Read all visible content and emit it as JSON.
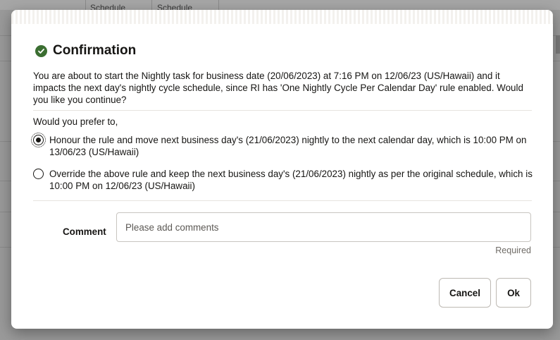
{
  "background": {
    "columns": [
      "Schedule",
      "Schedule"
    ]
  },
  "dialog": {
    "title": "Confirmation",
    "icon": "check-circle-icon",
    "accent_color": "#3b6e31",
    "message": "You are about to start the Nightly task for business date (20/06/2023) at 7:16 PM on 12/06/23 (US/Hawaii) and it impacts the next day's nightly cycle schedule, since RI has 'One Nightly Cycle Per Calendar Day' rule enabled. Would you like you continue?",
    "prompt": "Would you prefer to,",
    "options": [
      {
        "label": "Honour the rule and move next business day's (21/06/2023) nightly to the next calendar day, which is 10:00 PM on 13/06/23 (US/Hawaii)",
        "selected": true
      },
      {
        "label": "Override the above rule and keep the next business day's (21/06/2023) nightly as per the original schedule, which is 10:00 PM on 12/06/23 (US/Hawaii)",
        "selected": false
      }
    ],
    "comment": {
      "label": "Comment",
      "placeholder": "Please add comments",
      "value": "",
      "required_text": "Required"
    },
    "buttons": {
      "cancel": "Cancel",
      "ok": "Ok"
    }
  }
}
